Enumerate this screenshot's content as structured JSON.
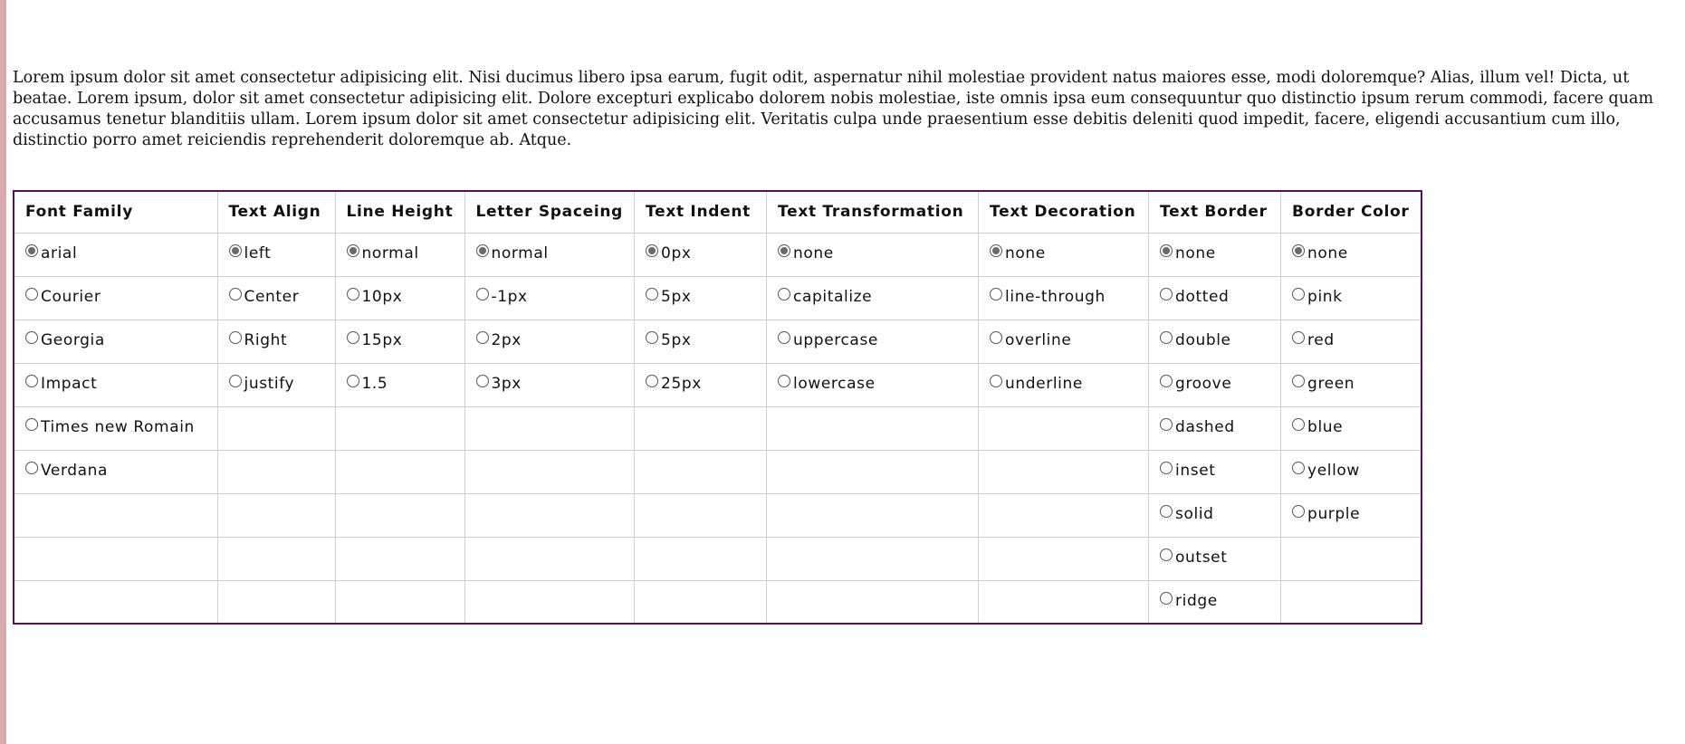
{
  "intro_text": "Lorem ipsum dolor sit amet consectetur adipisicing elit. Nisi ducimus libero ipsa earum, fugit odit, aspernatur nihil molestiae provident natus maiores esse, modi doloremque? Alias, illum vel! Dicta, ut beatae. Lorem ipsum, dolor sit amet consectetur adipisicing elit. Dolore excepturi explicabo dolorem nobis molestiae, iste omnis ipsa eum consequuntur quo distinctio ipsum rerum commodi, facere quam accusamus tenetur blanditiis ullam. Lorem ipsum dolor sit amet consectetur adipisicing elit. Veritatis culpa unde praesentium esse debitis deleniti quod impedit, facere, eligendi accusantium cum illo, distinctio porro amet reiciendis reprehenderit doloremque ab. Atque.",
  "columns": [
    {
      "key": "font-family",
      "header": "Font Family",
      "selected": 0,
      "options": [
        "arial",
        "Courier",
        "Georgia",
        "Impact",
        "Times new Romain",
        "Verdana"
      ]
    },
    {
      "key": "text-align",
      "header": "Text Align",
      "selected": 0,
      "options": [
        "left",
        "Center",
        "Right",
        "justify"
      ]
    },
    {
      "key": "line-height",
      "header": "Line Height",
      "selected": 0,
      "options": [
        "normal",
        "10px",
        "15px",
        "1.5"
      ]
    },
    {
      "key": "letter-spacing",
      "header": "Letter Spaceing",
      "selected": 0,
      "options": [
        "normal",
        "-1px",
        "2px",
        "3px"
      ]
    },
    {
      "key": "text-indent",
      "header": "Text Indent",
      "selected": 0,
      "options": [
        "0px",
        "5px",
        "5px",
        "25px"
      ]
    },
    {
      "key": "text-transformation",
      "header": "Text Transformation",
      "selected": 0,
      "options": [
        "none",
        "capitalize",
        "uppercase",
        "lowercase"
      ]
    },
    {
      "key": "text-decoration",
      "header": "Text Decoration",
      "selected": 0,
      "options": [
        "none",
        "line-through",
        "overline",
        "underline"
      ]
    },
    {
      "key": "text-border",
      "header": "Text Border",
      "selected": 0,
      "options": [
        "none",
        "dotted",
        "double",
        "groove",
        "dashed",
        "inset",
        "solid",
        "outset",
        "ridge"
      ]
    },
    {
      "key": "border-color",
      "header": "Border Color",
      "selected": 0,
      "options": [
        "none",
        "pink",
        "red",
        "green",
        "blue",
        "yellow",
        "purple"
      ]
    }
  ],
  "row_count": 9
}
